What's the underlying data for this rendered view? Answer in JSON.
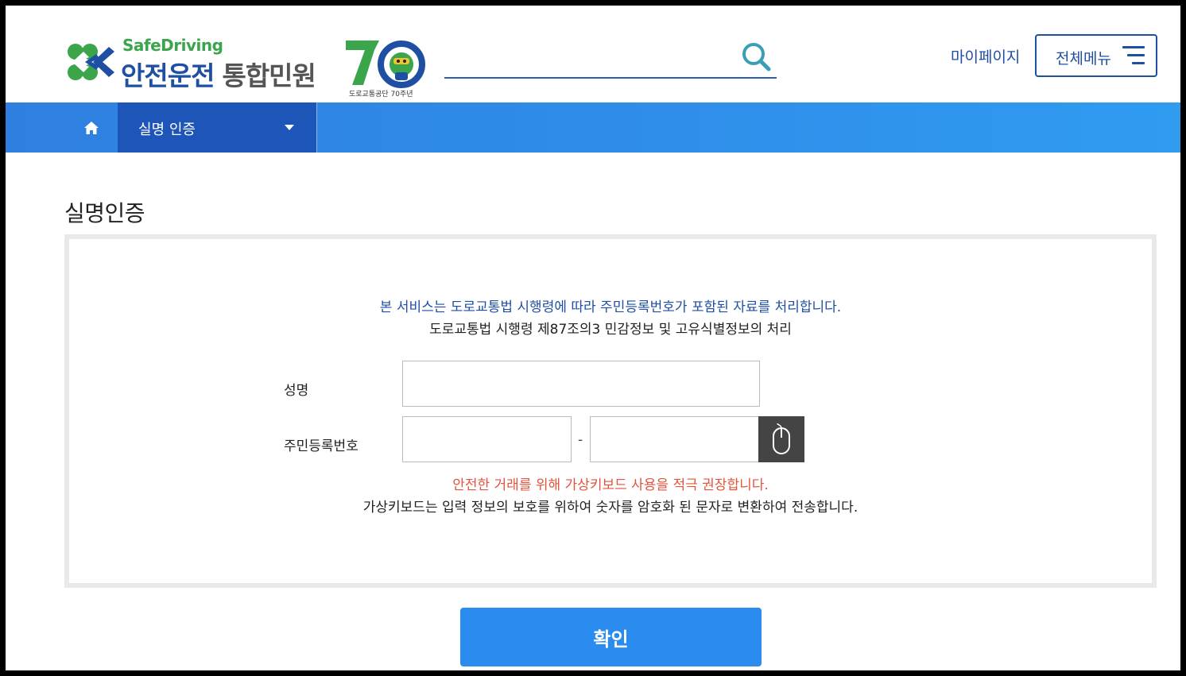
{
  "header": {
    "logo_sub": "SafeDriving",
    "logo_main_blue": "안전운전",
    "logo_main_gray": "통합민원",
    "logo_70_caption": "도로교통공단 70주년",
    "search": {
      "value": "",
      "placeholder": ""
    },
    "mypage_label": "마이페이지",
    "allmenu_label": "전체메뉴"
  },
  "nav": {
    "current_label": "실명 인증"
  },
  "main": {
    "title": "실명인증",
    "notice_line1": "본 서비스는 도로교통법 시행령에 따라 주민등록번호가 포함된 자료를 처리합니다.",
    "notice_line2": "도로교통법 시행령 제87조의3 민감정보 및 고유식별정보의 처리",
    "name_label": "성명",
    "name_value": "",
    "rrn_label": "주민등록번호",
    "rrn_front_value": "",
    "rrn_separator": "-",
    "rrn_back_value": "",
    "warning": "안전한 거래를 위해 가상키보드 사용을 적극 권장합니다.",
    "info": "가상키보드는 입력 정보의 보호를 위하여 숫자를 암호화 된 문자로 변환하여 전송합니다.",
    "confirm_label": "확인"
  },
  "colors": {
    "brand_blue": "#1e4fa3",
    "nav_bar": "#2f8fea",
    "nav_active": "#1e55b8",
    "warning_red": "#e4533b",
    "confirm_button": "#2b8cf0",
    "logo_green": "#3aa54a"
  },
  "icons": [
    "clover-logo-icon",
    "seventy-anniversary-icon",
    "search-icon",
    "hamburger-icon",
    "home-icon",
    "caret-down-icon",
    "mouse-icon"
  ]
}
